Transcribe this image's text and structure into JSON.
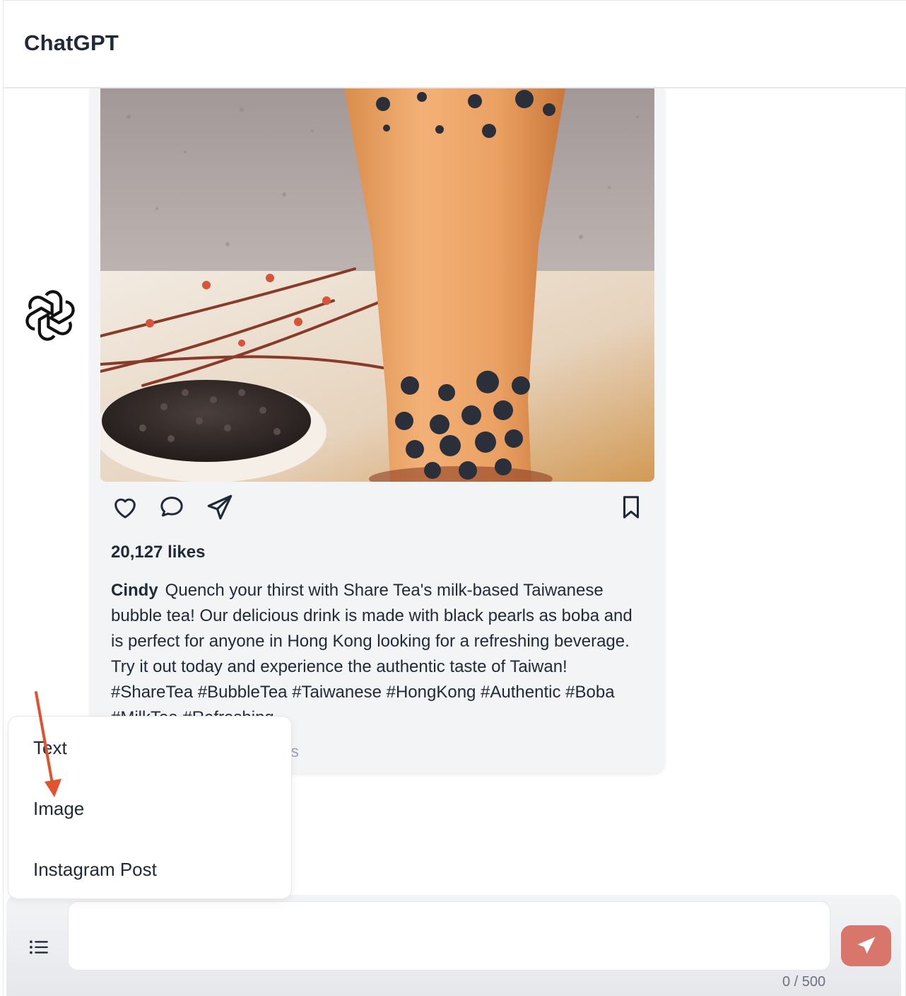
{
  "header": {
    "title": "ChatGPT"
  },
  "post": {
    "likes": "20,127 likes",
    "username": "Cindy",
    "caption_text": "Quench your thirst with Share Tea's milk-based Taiwanese bubble tea! Our delicious drink is made with black pearls as boba and is perfect for anyone in Hong Kong looking for a refreshing beverage. Try it out today and experience the authentic taste of Taiwan! #ShareTea #BubbleTea #Taiwanese #HongKong #Authentic #Boba #MilkTea #Refreshing",
    "comments_label": "ts",
    "icons": {
      "like": "heart-icon",
      "comment": "comment-icon",
      "share": "send-icon",
      "save": "bookmark-icon"
    }
  },
  "dropdown": {
    "items": [
      {
        "label": "Text"
      },
      {
        "label": "Image"
      },
      {
        "label": "Instagram Post"
      }
    ]
  },
  "composer": {
    "value": "",
    "counter": "0 / 500",
    "accent": "#d9766b"
  }
}
